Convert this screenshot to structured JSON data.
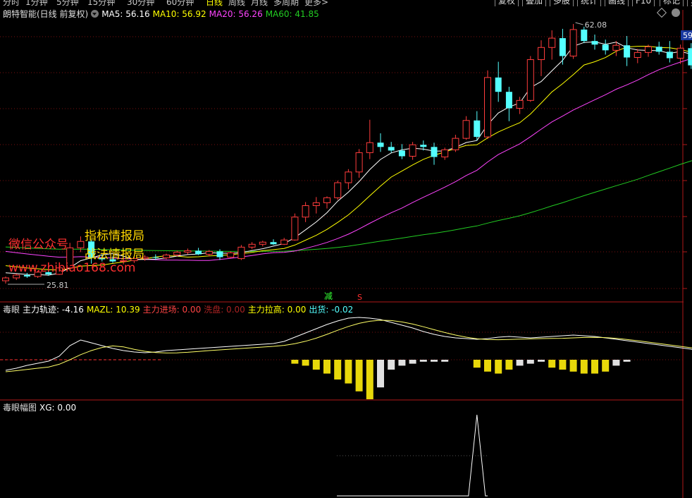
{
  "topbar": {
    "periods": [
      "分时",
      "1分钟",
      "5分钟",
      "15分钟",
      "30分钟",
      "60分钟",
      "日线",
      "周线",
      "月线",
      "多周期",
      "更多>"
    ],
    "active": "日线",
    "buttons": [
      "复权",
      "叠加",
      "多股",
      "统计",
      "画线",
      "F10",
      "标记",
      "自选"
    ]
  },
  "main": {
    "title": "朗特智能(日线 前复权)",
    "ma5": "MA5: 56.16",
    "ma10": "MA10: 56.92",
    "ma20": "MA20: 56.26",
    "ma60": "MA60: 41.85",
    "high_label": "62.08",
    "low_label": "25.81",
    "price_tag": "59",
    "marker_jian": "减",
    "marker_s": "S",
    "watermark": {
      "line1": "微信公众号",
      "line2": "指标情报局",
      "line3": "战法情报局",
      "line4": "www.zhibiao168.com"
    },
    "colors": {
      "up": "#ff3c3c",
      "down": "#54ffff",
      "ma5": "#ffffff",
      "ma10": "#ffff00",
      "ma20": "#ff44ff",
      "ma60": "#22cc22"
    }
  },
  "ind1": {
    "name": "毒眼",
    "track": "主力轨迹: -4.16",
    "mazl": "MAZL: 10.39",
    "enter": "主力进场: 0.00",
    "wash": "洗盘: 0.00",
    "raise": "主力拉高: 0.00",
    "ship": "出货: -0.02"
  },
  "ind2": {
    "name": "毒眼幅图",
    "xg": "XG: 0.00"
  },
  "chart_data": {
    "type": "candlestick",
    "series_note": "daily OHLC, price axis from 25.81 (low) to 62.08 (high)",
    "candles": [
      [
        26.2,
        26.8,
        25.81,
        26.6
      ],
      [
        26.6,
        27.2,
        26.3,
        27.0
      ],
      [
        27.0,
        27.3,
        26.6,
        26.8
      ],
      [
        26.8,
        27.6,
        26.6,
        27.4
      ],
      [
        27.4,
        27.6,
        26.9,
        27.1
      ],
      [
        27.1,
        28.3,
        27.0,
        28.0
      ],
      [
        28.0,
        31.5,
        27.9,
        30.8
      ],
      [
        30.8,
        32.4,
        30.2,
        31.7
      ],
      [
        31.7,
        32.0,
        28.6,
        29.4
      ],
      [
        29.4,
        29.8,
        28.9,
        29.2
      ],
      [
        29.2,
        29.6,
        28.7,
        28.9
      ],
      [
        28.9,
        29.4,
        28.5,
        29.0
      ],
      [
        29.0,
        29.5,
        28.7,
        29.3
      ],
      [
        29.3,
        29.8,
        29.0,
        29.5
      ],
      [
        29.5,
        29.9,
        29.1,
        29.4
      ],
      [
        29.4,
        30.0,
        29.2,
        29.8
      ],
      [
        29.8,
        30.4,
        29.6,
        30.2
      ],
      [
        30.2,
        30.7,
        29.9,
        30.4
      ],
      [
        30.4,
        30.8,
        29.8,
        29.9
      ],
      [
        29.9,
        30.5,
        29.6,
        30.3
      ],
      [
        30.3,
        30.6,
        29.1,
        29.5
      ],
      [
        29.5,
        30.3,
        29.4,
        30.1
      ],
      [
        29.3,
        31.2,
        29.1,
        30.9
      ],
      [
        30.9,
        31.6,
        30.6,
        31.3
      ],
      [
        31.3,
        31.8,
        31.0,
        31.6
      ],
      [
        31.6,
        32.0,
        31.2,
        31.3
      ],
      [
        31.3,
        32.2,
        31.2,
        31.9
      ],
      [
        31.9,
        35.6,
        31.8,
        35.1
      ],
      [
        35.1,
        37.2,
        34.4,
        36.7
      ],
      [
        36.7,
        37.9,
        35.6,
        37.1
      ],
      [
        37.1,
        38.0,
        36.3,
        37.8
      ],
      [
        37.8,
        40.2,
        37.5,
        39.9
      ],
      [
        39.9,
        41.8,
        39.0,
        41.4
      ],
      [
        41.4,
        44.6,
        40.6,
        44.1
      ],
      [
        44.1,
        48.7,
        43.2,
        45.5
      ],
      [
        45.5,
        46.8,
        44.2,
        44.9
      ],
      [
        44.9,
        45.6,
        44.1,
        44.4
      ],
      [
        44.4,
        45.3,
        43.2,
        43.6
      ],
      [
        43.6,
        45.6,
        43.1,
        45.2
      ],
      [
        45.2,
        45.8,
        44.4,
        44.9
      ],
      [
        44.9,
        45.5,
        42.4,
        43.5
      ],
      [
        43.5,
        44.8,
        43.1,
        44.5
      ],
      [
        44.5,
        46.6,
        44.2,
        46.1
      ],
      [
        46.1,
        49.2,
        45.9,
        48.6
      ],
      [
        48.6,
        49.9,
        45.8,
        46.3
      ],
      [
        46.3,
        55.6,
        46.0,
        54.6
      ],
      [
        54.6,
        56.8,
        51.2,
        52.6
      ],
      [
        52.6,
        53.3,
        48.5,
        50.3
      ],
      [
        50.3,
        51.9,
        49.5,
        51.4
      ],
      [
        51.4,
        57.6,
        51.2,
        57.1
      ],
      [
        57.1,
        59.8,
        54.8,
        58.8
      ],
      [
        58.8,
        61.2,
        57.1,
        60.1
      ],
      [
        60.1,
        61.4,
        56.4,
        57.6
      ],
      [
        57.6,
        62.08,
        57.2,
        61.3
      ],
      [
        61.3,
        61.7,
        59.4,
        59.7
      ],
      [
        59.7,
        60.6,
        58.5,
        59.2
      ],
      [
        59.2,
        59.9,
        57.8,
        58.4
      ],
      [
        58.4,
        59.7,
        57.6,
        59.1
      ],
      [
        59.1,
        60.4,
        56.2,
        57.4
      ],
      [
        57.4,
        58.6,
        56.6,
        58.1
      ],
      [
        58.1,
        59.2,
        57.5,
        58.9
      ],
      [
        58.9,
        59.6,
        57.8,
        58.2
      ],
      [
        58.2,
        59.7,
        56.7,
        57.3
      ],
      [
        57.3,
        59.2,
        56.5,
        58.7
      ],
      [
        58.7,
        59.4,
        55.8,
        56.3
      ],
      [
        56.3,
        57.2,
        53.9,
        54.6
      ],
      [
        54.6,
        55.9,
        52.3,
        53.6
      ]
    ],
    "ma_last": {
      "MA5": 56.16,
      "MA10": 56.92,
      "MA20": 56.26,
      "MA60": 41.85
    },
    "ind1_hist": [
      0,
      0,
      0,
      0,
      0,
      0,
      0,
      0,
      0,
      0,
      0,
      0,
      0,
      0,
      0,
      0,
      0,
      0,
      0,
      0,
      0,
      0,
      0,
      0,
      0,
      0,
      0,
      -2,
      -3,
      -5,
      -7,
      -10,
      -12,
      -16,
      -20,
      -14,
      -5,
      -3,
      -2,
      -1,
      -1,
      -1,
      0,
      0,
      -4,
      -6,
      -7,
      -5,
      -3,
      -2,
      -1,
      -4,
      -5,
      -6,
      -7,
      -7,
      -6,
      -3,
      -1,
      0,
      0,
      0,
      0,
      0,
      0,
      0,
      0
    ],
    "ind2_xg": {
      "peak_bar": 44,
      "value_peak": 1,
      "baseline": 0
    }
  }
}
